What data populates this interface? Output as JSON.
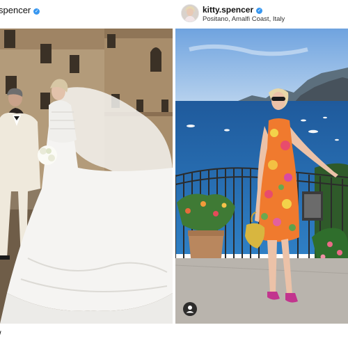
{
  "left_post": {
    "username": "spencer",
    "verified": true,
    "caption": "/"
  },
  "right_post": {
    "username": "kitty.spencer",
    "verified": true,
    "location": "Positano, Amalfi Coast, Italy",
    "user_tag_icon": "user-tag-icon"
  }
}
